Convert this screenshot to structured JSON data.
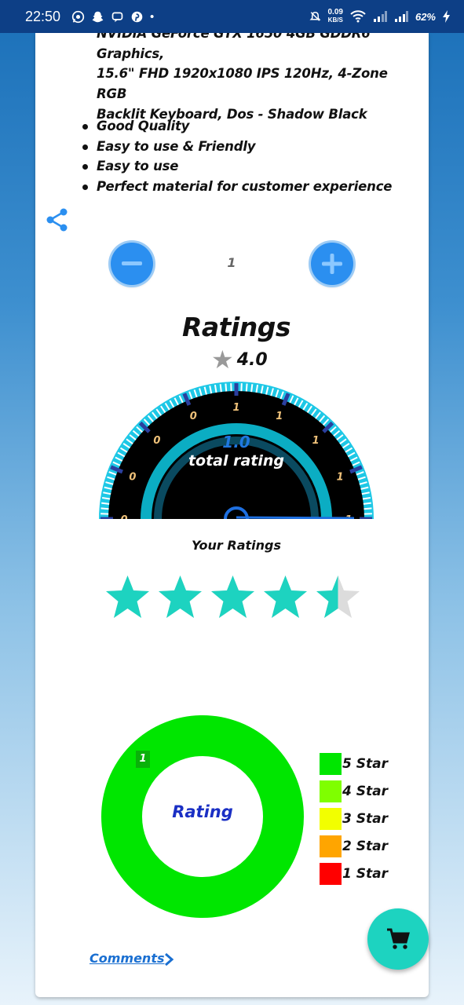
{
  "status_bar": {
    "time": "22:50",
    "app_icons": [
      "whatsapp-icon",
      "snapchat-icon",
      "chat-bot-icon",
      "pinterest-icon",
      "dot-icon"
    ],
    "speed_value": "0.09",
    "speed_unit": "KB/S",
    "battery": "62%"
  },
  "product": {
    "description_lines": [
      "NVIDIA GeForce GTX 1650 4GB GDDR6 Graphics,",
      "15.6\" FHD 1920x1080 IPS 120Hz, 4-Zone RGB",
      "Backlit Keyboard, Dos - Shadow Black"
    ],
    "features": [
      "Good Quality",
      "Easy to use & Friendly",
      "Easy to use",
      "Perfect material for customer experience"
    ]
  },
  "quantity": {
    "value": "1",
    "minus_label": "−",
    "plus_label": "+"
  },
  "ratings": {
    "title": "Ratings",
    "average": "4.0",
    "gauge_value": "1.0",
    "gauge_label": "total rating",
    "gauge_ticks": [
      "0",
      "0",
      "0",
      "0",
      "1",
      "1",
      "1",
      "1",
      "1"
    ],
    "your_ratings_label": "Your Ratings",
    "your_rating_stars": 4.5,
    "accent_color": "#1dd3c0"
  },
  "rating_chart": {
    "center_label": "Rating",
    "segment_tag": "1",
    "legend": [
      {
        "label": "5 Star",
        "color": "#00e600"
      },
      {
        "label": "4 Star",
        "color": "#7fff00"
      },
      {
        "label": "3 Star",
        "color": "#f2ff00"
      },
      {
        "label": "2 Star",
        "color": "#ffa500"
      },
      {
        "label": "1 Star",
        "color": "#ff0000"
      }
    ]
  },
  "comments": {
    "label": "Comments"
  },
  "cart_fab": {
    "icon": "cart-icon"
  }
}
